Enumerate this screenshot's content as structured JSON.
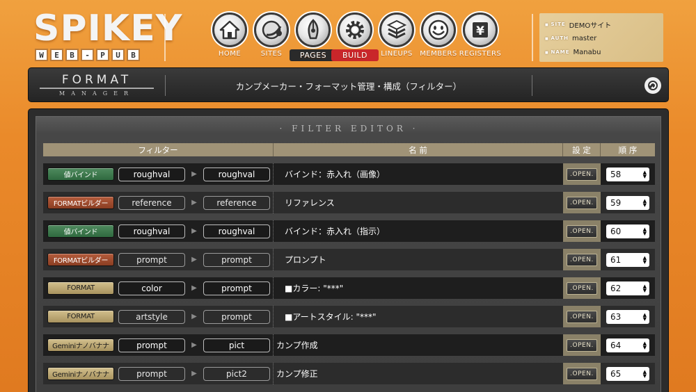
{
  "brand": {
    "name": "SPIKEY",
    "sub_letters": [
      "W",
      "E",
      "B",
      "-",
      "P",
      "U",
      "B"
    ]
  },
  "nav": [
    {
      "label": "HOME",
      "icon": "house-icon",
      "state": "normal"
    },
    {
      "label": "SITES",
      "icon": "globe-icon",
      "state": "normal"
    },
    {
      "label": "PAGES",
      "icon": "pen-nib-icon",
      "state": "active"
    },
    {
      "label": "BUILD",
      "icon": "gear-icon",
      "state": "active-red"
    },
    {
      "label": "LINEUPS",
      "icon": "stack-icon",
      "state": "normal"
    },
    {
      "label": "MEMBERS",
      "icon": "smiley-icon",
      "state": "normal"
    },
    {
      "label": "REGISTERS",
      "icon": "yen-icon",
      "state": "normal"
    }
  ],
  "info": {
    "site_key": "SITE",
    "site_value": "DEMOサイト",
    "auth_key": "AUTH",
    "auth_value": "master",
    "name_key": "NAME",
    "name_value": "Manabu"
  },
  "titlebar": {
    "logo_top": "FORMAT",
    "logo_bottom": "MANAGER",
    "title": "カンプメーカー・フォーマット管理・構成（フィルター）"
  },
  "panel": {
    "title": "· FILTER EDITOR ·",
    "headers": {
      "filter": "フィルター",
      "name": "名 前",
      "setting": "設 定",
      "order": "順 序"
    }
  },
  "colors": {
    "green_tag": "#2f6a3f",
    "brown_tag": "#8a3d22",
    "tan_tag": "#a8935f",
    "header": "#a09377"
  },
  "rows": [
    {
      "tag": "値バインド",
      "tag_color": "green",
      "from": "roughval",
      "to": "roughval",
      "name": "バインド：赤入れ（画像）",
      "open": ".OPEN.",
      "order": "58"
    },
    {
      "tag": "FORMATビルダー",
      "tag_color": "brown",
      "from": "reference",
      "to": "reference",
      "name": "リファレンス",
      "open": ".OPEN.",
      "order": "59"
    },
    {
      "tag": "値バインド",
      "tag_color": "green",
      "from": "roughval",
      "to": "roughval",
      "name": "バインド：赤入れ（指示）",
      "open": ".OPEN.",
      "order": "60"
    },
    {
      "tag": "FORMATビルダー",
      "tag_color": "brown",
      "from": "prompt",
      "to": "prompt",
      "name": "プロンプト",
      "open": ".OPEN.",
      "order": "61"
    },
    {
      "tag": "FORMAT",
      "tag_color": "tan",
      "from": "color",
      "to": "prompt",
      "name": "■カラー: \"***\"",
      "open": ".OPEN.",
      "order": "62"
    },
    {
      "tag": "FORMAT",
      "tag_color": "tan",
      "from": "artstyle",
      "to": "prompt",
      "name": "■アートスタイル: \"***\"",
      "open": ".OPEN.",
      "order": "63"
    },
    {
      "tag": "Geminiナノバナナ",
      "tag_color": "tan",
      "from": "prompt",
      "to": "pict",
      "name": "カンプ作成",
      "open": ".OPEN.",
      "order": "64"
    },
    {
      "tag": "Geminiナノバナナ",
      "tag_color": "tan",
      "from": "prompt",
      "to": "pict2",
      "name": "カンプ修正",
      "open": ".OPEN.",
      "order": "65"
    }
  ]
}
